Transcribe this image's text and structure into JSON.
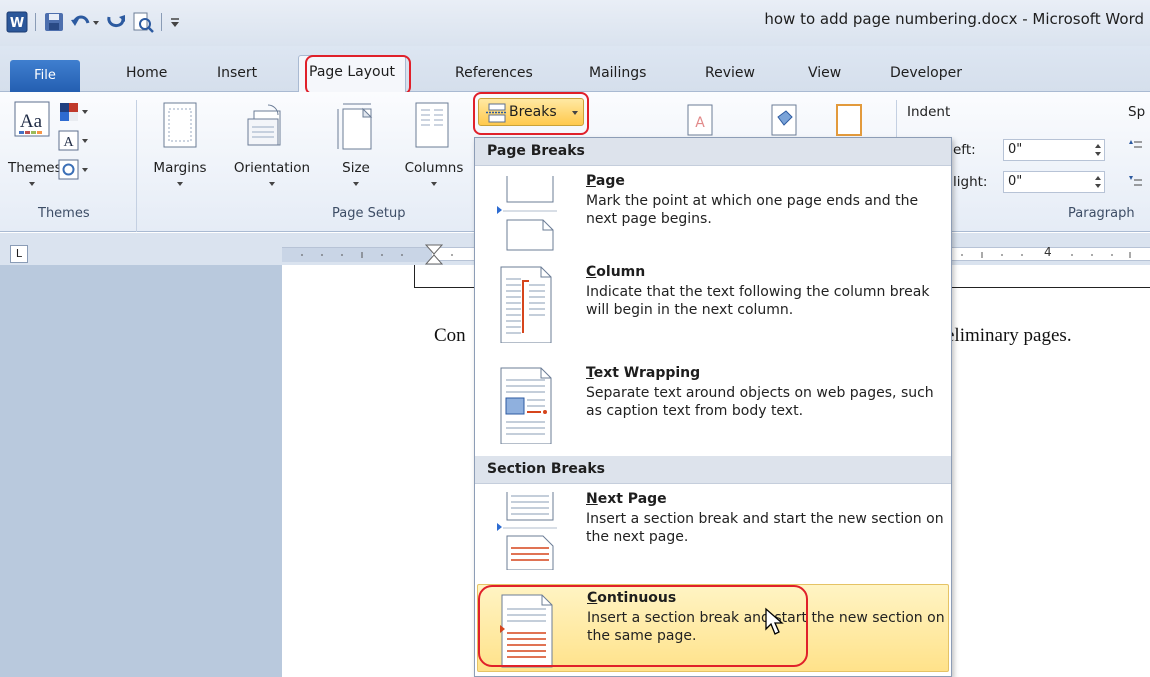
{
  "title_bar": {
    "document_title": "how to add page numbering.docx - Microsoft Word"
  },
  "quick_access": {
    "icons": [
      "word-icon",
      "save-icon",
      "undo-icon",
      "redo-icon",
      "print-preview-icon",
      "customize-icon"
    ]
  },
  "tabs": [
    {
      "label": "File"
    },
    {
      "label": "Home"
    },
    {
      "label": "Insert"
    },
    {
      "label": "Page Layout",
      "active": true
    },
    {
      "label": "References"
    },
    {
      "label": "Mailings"
    },
    {
      "label": "Review"
    },
    {
      "label": "View"
    },
    {
      "label": "Developer"
    }
  ],
  "ribbon": {
    "themes": {
      "button_label": "Themes",
      "group_label": "Themes"
    },
    "page_setup": {
      "margins_label": "Margins",
      "orientation_label": "Orientation",
      "size_label": "Size",
      "columns_label": "Columns",
      "group_label": "Page Setup"
    },
    "breaks_label": "Breaks",
    "paragraph": {
      "indent_label": "Indent",
      "left_label": "eft:",
      "left_value": "0\"",
      "right_label": "light:",
      "right_value": "0\"",
      "spacing_label": "Sp",
      "group_label": "Paragraph"
    }
  },
  "ruler": {
    "number": "4"
  },
  "document": {
    "text_left": "Con",
    "text_right": "eliminary pages."
  },
  "menu": {
    "page_breaks_header": "Page Breaks",
    "section_breaks_header": "Section Breaks",
    "items": [
      {
        "title": "Page",
        "accel": "P",
        "rest": "age",
        "desc": "Mark the point at which one page ends and the next page begins."
      },
      {
        "title": "Column",
        "accel": "C",
        "rest": "olumn",
        "desc": "Indicate that the text following the column break will begin in the next column."
      },
      {
        "title": "Text Wrapping",
        "accel": "T",
        "rest": "ext Wrapping",
        "desc": "Separate text around objects on web pages, such as caption text from body text."
      },
      {
        "title": "Next Page",
        "accel": "N",
        "rest": "ext Page",
        "desc": "Insert a section break and start the new section on the next page."
      },
      {
        "title": "Continuous",
        "accel": "C",
        "rest": "ontinuous",
        "desc": "Insert a section break and start the new section on the same page.",
        "highlighted": true
      }
    ]
  },
  "colors": {
    "highlight": "#ffe28a",
    "annotation": "#e0202a",
    "file_tab": "#2f6fc2"
  }
}
